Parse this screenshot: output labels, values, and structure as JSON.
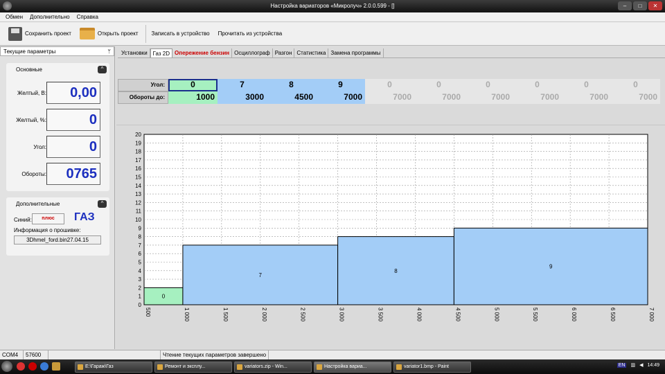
{
  "window": {
    "title": "Настройка вариаторов «Микролуч» 2.0.0.599 - []"
  },
  "menu": [
    "Обмен",
    "Дополнительно",
    "Справка"
  ],
  "toolbar": {
    "save_project": "Сохранить проект",
    "open_project": "Открыть проект",
    "write_device": "Записать в устройство",
    "read_device": "Прочитать из устройства"
  },
  "sidebar": {
    "header": "Текущие параметры",
    "pin": "ᛘ",
    "main_title": "Основные",
    "collapse_glyph": "^",
    "params": [
      {
        "label": "Желтый, В:",
        "value": "0,00"
      },
      {
        "label": "Желтый, %:",
        "value": "0"
      },
      {
        "label": "Угол:",
        "value": "0"
      },
      {
        "label": "Обороты:",
        "value": "0765"
      }
    ],
    "extra_title": "Дополнительные",
    "blue_label": "Синий:",
    "blue_value": "плюс",
    "fuel": "ГАЗ",
    "firmware_label": "Информация о прошивке:",
    "firmware_value": "3Dhmel_ford.bin27.04.15"
  },
  "tabs": [
    {
      "label": "Установки",
      "active": false,
      "red": false
    },
    {
      "label": "Газ 2D",
      "active": true,
      "red": false
    },
    {
      "label": "Опережение бензин",
      "active": false,
      "red": true
    },
    {
      "label": "Осциллограф",
      "active": false,
      "red": false
    },
    {
      "label": "Разгон",
      "active": false,
      "red": false
    },
    {
      "label": "Статистика",
      "active": false,
      "red": false
    },
    {
      "label": "Замена программы",
      "active": false,
      "red": false
    }
  ],
  "table": {
    "angle_label": "Угол:",
    "rpm_label": "Обороты до:",
    "angles": [
      "0",
      "7",
      "8",
      "9",
      "0",
      "0",
      "0",
      "0",
      "0",
      "0"
    ],
    "rpm": [
      "1000",
      "3000",
      "4500",
      "7000",
      "7000",
      "7000",
      "7000",
      "7000",
      "7000",
      "7000"
    ],
    "active_count": 4
  },
  "chart_data": {
    "type": "bar",
    "xlim": [
      500,
      7000
    ],
    "ylim": [
      0,
      20
    ],
    "yticks": [
      "0",
      "1",
      "2",
      "3",
      "4",
      "5",
      "6",
      "7",
      "8",
      "9",
      "10",
      "11",
      "12",
      "13",
      "14",
      "15",
      "16",
      "17",
      "18",
      "19",
      "20"
    ],
    "xticks": [
      "500",
      "1 000",
      "1 500",
      "2 000",
      "2 500",
      "3 000",
      "3 500",
      "4 000",
      "4 500",
      "5 000",
      "5 500",
      "6 000",
      "6 500",
      "7 000"
    ],
    "bars": [
      {
        "x0": 500,
        "x1": 1000,
        "value": 0,
        "label": "0"
      },
      {
        "x0": 1000,
        "x1": 3000,
        "value": 7,
        "label": "7"
      },
      {
        "x0": 3000,
        "x1": 4500,
        "value": 8,
        "label": "8"
      },
      {
        "x0": 4500,
        "x1": 7000,
        "value": 9,
        "label": "9"
      }
    ],
    "grid": true,
    "colors": {
      "bar": "#a3cdf7",
      "first_bar": "#a6f0c0"
    }
  },
  "status": {
    "port": "COM4",
    "baud": "57600",
    "message": "Чтение текущих параметров завершено"
  },
  "taskbar": {
    "items": [
      "E:\\Гараж\\Газ",
      "Ремонт и эксплу...",
      "variators.zip - Win...",
      "Настройка вариа...",
      "variator1.bmp - Paint"
    ],
    "lang": "EN",
    "time": "14:49"
  }
}
